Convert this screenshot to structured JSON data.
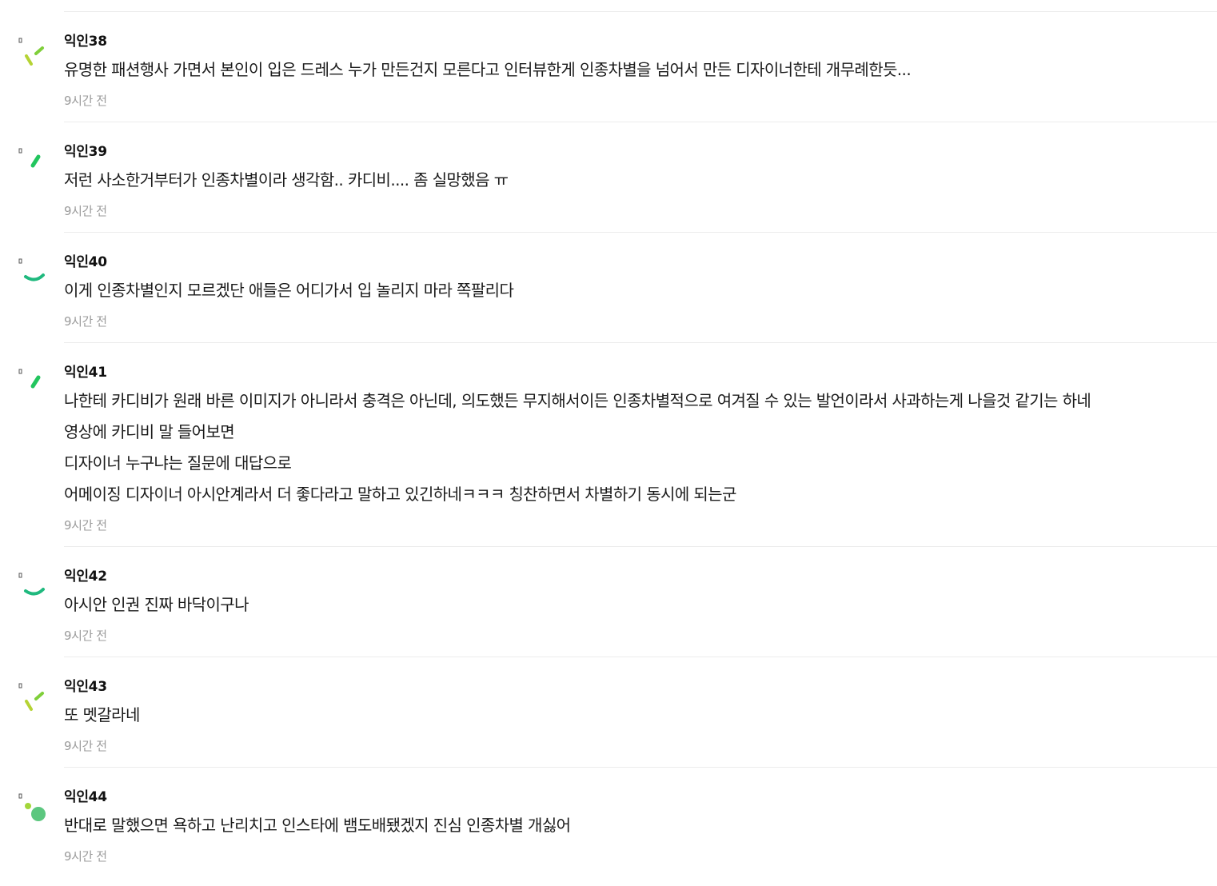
{
  "comments": [
    {
      "author": "익인38",
      "lines": [
        "유명한 패션행사 가면서 본인이 입은 드레스 누가 만든건지 모른다고 인터뷰한게 인종차별을 넘어서 만든 디자이너한테 개무례한듯..."
      ],
      "time": "9시간 전",
      "avatar_icon": "avatar-lime-check-icon"
    },
    {
      "author": "익인39",
      "lines": [
        "저런 사소한거부터가 인종차별이라 생각함.. 카디비.... 좀 실망했음 ㅠ"
      ],
      "time": "9시간 전",
      "avatar_icon": "avatar-green-slash-icon"
    },
    {
      "author": "익인40",
      "lines": [
        "이게 인종차별인지 모르겠단 애들은 어디가서 입 놀리지 마라 쪽팔리다"
      ],
      "time": "9시간 전",
      "avatar_icon": "avatar-teal-smile-icon"
    },
    {
      "author": "익인41",
      "lines": [
        "나한테 카디비가 원래 바른 이미지가 아니라서 충격은 아닌데, 의도했든 무지해서이든 인종차별적으로 여겨질 수 있는 발언이라서 사과하는게 나을것 같기는 하네",
        "영상에 카디비 말 들어보면",
        "디자이너 누구냐는 질문에 대답으로",
        "어메이징 디자이너 아시안계라서 더 좋다라고 말하고 있긴하네ㅋㅋㅋ 칭찬하면서 차별하기 동시에 되는군"
      ],
      "time": "9시간 전",
      "avatar_icon": "avatar-green-slash-icon"
    },
    {
      "author": "익인42",
      "lines": [
        "아시안 인권 진짜 바닥이구나"
      ],
      "time": "9시간 전",
      "avatar_icon": "avatar-teal-smile-icon"
    },
    {
      "author": "익인43",
      "lines": [
        "또 멧갈라네"
      ],
      "time": "9시간 전",
      "avatar_icon": "avatar-lime-check-icon"
    },
    {
      "author": "익인44",
      "lines": [
        "반대로 말했으면 욕하고 난리치고 인스타에 뱀도배됐겠지 진심 인종차별 개싫어"
      ],
      "time": "9시간 전",
      "avatar_icon": "avatar-green-dots-icon"
    }
  ],
  "colors": {
    "lime": "#b5d334",
    "green": "#22c55e",
    "teal": "#1fb97e",
    "dot_green": "#5cc77f",
    "dot_lime": "#a3d63a",
    "time_gray": "#9b9b9b",
    "divider": "#ececec"
  }
}
